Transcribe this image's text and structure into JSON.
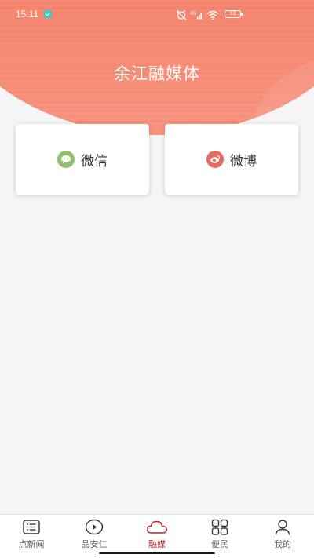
{
  "status_bar": {
    "time": "15:11",
    "battery": "93",
    "icons": [
      "notification-check-icon",
      "alarm-icon",
      "signal-icon",
      "wifi-icon",
      "battery-icon"
    ]
  },
  "header": {
    "title": "余江融媒体",
    "gradient_colors": [
      "#ef6b56",
      "#f7927c"
    ]
  },
  "cards": [
    {
      "label": "微信",
      "icon": "wechat-icon",
      "icon_color": "#8fbf6b"
    },
    {
      "label": "微博",
      "icon": "weibo-icon",
      "icon_color": "#e66a5e"
    }
  ],
  "tabbar": {
    "active_color": "#b8272c",
    "inactive_color": "#666666",
    "tabs": [
      {
        "label": "点新闻",
        "icon": "news-list-icon",
        "active": false
      },
      {
        "label": "品安仁",
        "icon": "play-circle-icon",
        "active": false
      },
      {
        "label": "融媒",
        "icon": "cloud-icon",
        "active": true
      },
      {
        "label": "便民",
        "icon": "grid-icon",
        "active": false
      },
      {
        "label": "我的",
        "icon": "person-icon",
        "active": false
      }
    ]
  }
}
